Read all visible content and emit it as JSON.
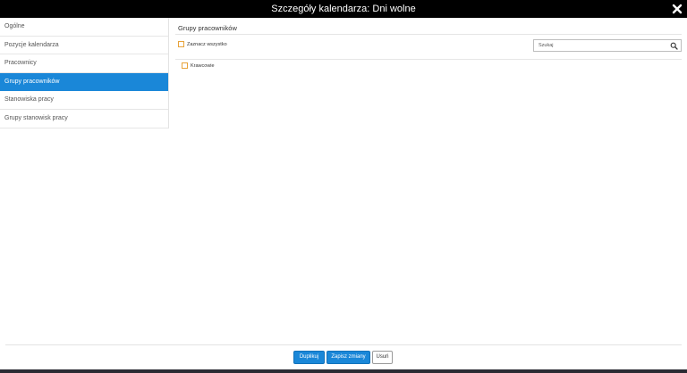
{
  "dialog": {
    "title": "Szczegóły kalendarza: Dni wolne"
  },
  "sidebar": {
    "items": [
      {
        "label": "Ogólne"
      },
      {
        "label": "Pozycje kalendarza"
      },
      {
        "label": "Pracownicy"
      },
      {
        "label": "Grupy pracowników"
      },
      {
        "label": "Stanowiska pracy"
      },
      {
        "label": "Grupy stanowisk pracy"
      }
    ],
    "active_index": 3
  },
  "main": {
    "section_title": "Grupy pracowników",
    "select_all_label": "Zaznacz wszystko",
    "search": {
      "placeholder": "Szukaj",
      "value": ""
    },
    "groups": [
      {
        "label": "Krawcowie",
        "checked": false
      }
    ]
  },
  "footer": {
    "duplicate_label": "Duplikuj",
    "save_label": "Zapisz zmiany",
    "delete_label": "Usuń"
  },
  "colors": {
    "accent": "#1a87d8",
    "checkbox_border": "#e8a33a",
    "titlebar": "#000000"
  }
}
